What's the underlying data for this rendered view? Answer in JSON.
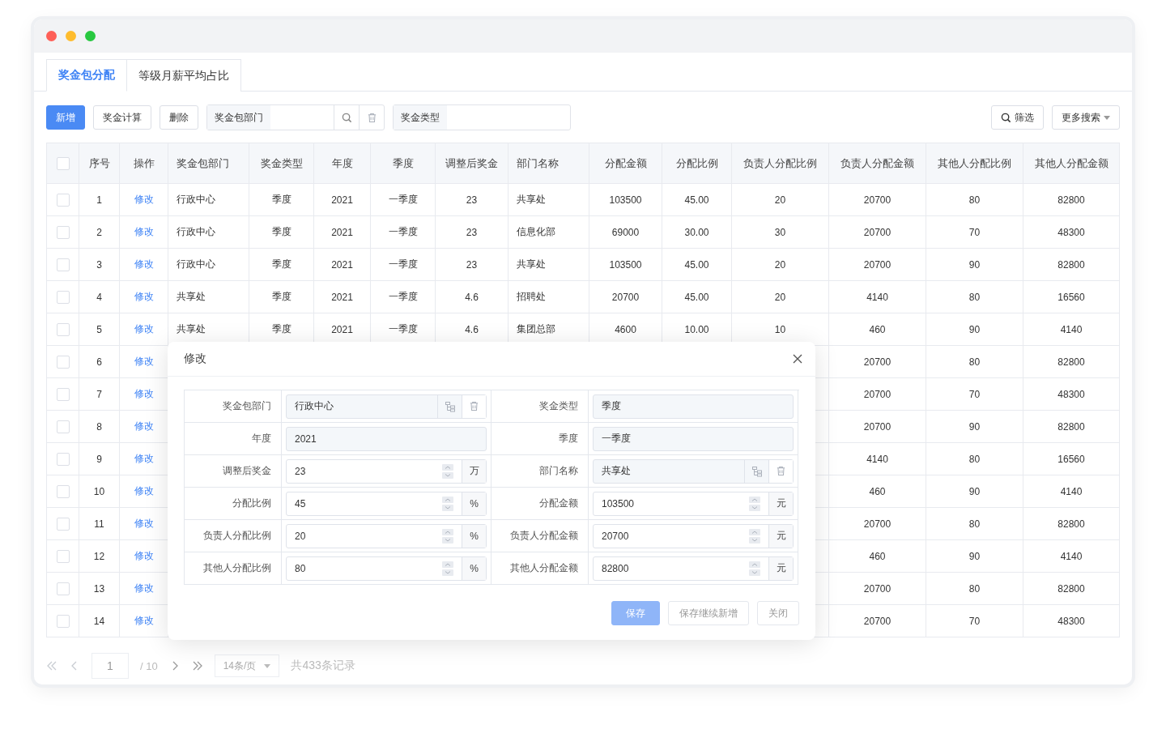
{
  "tabs": [
    {
      "label": "奖金包分配",
      "selected": true
    },
    {
      "label": "等级月薪平均占比",
      "selected": false
    }
  ],
  "toolbar": {
    "buttons": [
      {
        "label": "新增",
        "kind": "primary"
      },
      {
        "label": "奖金计算",
        "kind": "default"
      },
      {
        "label": "删除",
        "kind": "default"
      }
    ],
    "filters": [
      {
        "label": "奖金包部门",
        "kind": "search"
      },
      {
        "label": "奖金类型",
        "kind": "plain"
      }
    ],
    "right_buttons": [
      {
        "label": "筛选",
        "kind": "search"
      },
      {
        "label": "更多搜索",
        "kind": "dropdown"
      }
    ]
  },
  "table": {
    "select_all": {
      "checked": false
    },
    "columns": [
      "序号",
      "操作",
      "奖金包部门",
      "奖金类型",
      "年度",
      "季度",
      "调整后奖金",
      "部门名称",
      "分配金额",
      "分配比例",
      "负责人分配比例",
      "负责人分配金额",
      "其他人分配比例",
      "其他人分配金额"
    ],
    "rows": [
      {
        "checked": false,
        "cells": [
          "1",
          "修改",
          "行政中心",
          "季度",
          "2021",
          "一季度",
          "23",
          "共享处",
          "103500",
          "45.00",
          "20",
          "20700",
          "80",
          "82800"
        ]
      },
      {
        "checked": false,
        "cells": [
          "2",
          "修改",
          "行政中心",
          "季度",
          "2021",
          "一季度",
          "23",
          "信息化部",
          "69000",
          "30.00",
          "30",
          "20700",
          "70",
          "48300"
        ]
      },
      {
        "checked": false,
        "cells": [
          "3",
          "修改",
          "行政中心",
          "季度",
          "2021",
          "一季度",
          "23",
          "共享处",
          "103500",
          "45.00",
          "20",
          "20700",
          "90",
          "82800"
        ]
      },
      {
        "checked": false,
        "cells": [
          "4",
          "修改",
          "共享处",
          "季度",
          "2021",
          "一季度",
          "4.6",
          "招聘处",
          "20700",
          "45.00",
          "20",
          "4140",
          "80",
          "16560"
        ]
      },
      {
        "checked": false,
        "cells": [
          "5",
          "修改",
          "共享处",
          "季度",
          "2021",
          "一季度",
          "4.6",
          "集团总部",
          "4600",
          "10.00",
          "10",
          "460",
          "90",
          "4140"
        ]
      },
      {
        "checked": false,
        "cells": [
          "6",
          "修改",
          null,
          null,
          null,
          null,
          null,
          null,
          null,
          null,
          null,
          "20700",
          "80",
          "82800"
        ]
      },
      {
        "checked": false,
        "cells": [
          "7",
          "修改",
          null,
          null,
          null,
          null,
          null,
          null,
          null,
          null,
          null,
          "20700",
          "70",
          "48300"
        ]
      },
      {
        "checked": false,
        "cells": [
          "8",
          "修改",
          null,
          null,
          null,
          null,
          null,
          null,
          null,
          null,
          null,
          "20700",
          "90",
          "82800"
        ]
      },
      {
        "checked": false,
        "cells": [
          "9",
          "修改",
          null,
          null,
          null,
          null,
          null,
          null,
          null,
          null,
          null,
          "4140",
          "80",
          "16560"
        ]
      },
      {
        "checked": false,
        "cells": [
          "10",
          "修改",
          null,
          null,
          null,
          null,
          null,
          null,
          null,
          null,
          null,
          "460",
          "90",
          "4140"
        ]
      },
      {
        "checked": false,
        "cells": [
          "11",
          "修改",
          null,
          null,
          null,
          null,
          null,
          null,
          null,
          null,
          null,
          "20700",
          "80",
          "82800"
        ]
      },
      {
        "checked": false,
        "cells": [
          "12",
          "修改",
          null,
          null,
          null,
          null,
          null,
          null,
          null,
          null,
          null,
          "460",
          "90",
          "4140"
        ]
      },
      {
        "checked": false,
        "cells": [
          "13",
          "修改",
          null,
          null,
          null,
          null,
          null,
          null,
          null,
          null,
          null,
          "20700",
          "80",
          "82800"
        ]
      },
      {
        "checked": false,
        "cells": [
          "14",
          "修改",
          null,
          null,
          null,
          null,
          null,
          null,
          null,
          null,
          null,
          "20700",
          "70",
          "48300"
        ]
      }
    ]
  },
  "pagination": {
    "page": "1",
    "total_pages": "/ 10",
    "page_size": "14条/页",
    "summary": "共433条记录"
  },
  "dialog": {
    "title": "修改",
    "fields": [
      {
        "label": "奖金包部门",
        "value": "行政中心",
        "kind": "select"
      },
      {
        "label": "奖金类型",
        "value": "季度",
        "kind": "text"
      },
      {
        "label": "年度",
        "value": "2021",
        "kind": "text"
      },
      {
        "label": "季度",
        "value": "一季度",
        "kind": "text"
      },
      {
        "label": "调整后奖金",
        "value": "23",
        "kind": "number",
        "unit": "万"
      },
      {
        "label": "部门名称",
        "value": "共享处",
        "kind": "select"
      },
      {
        "label": "分配比例",
        "value": "45",
        "kind": "number",
        "unit": "%"
      },
      {
        "label": "分配金额",
        "value": "103500",
        "kind": "number",
        "unit": "元"
      },
      {
        "label": "负责人分配比例",
        "value": "20",
        "kind": "number",
        "unit": "%"
      },
      {
        "label": "负责人分配金额",
        "value": "20700",
        "kind": "number",
        "unit": "元"
      },
      {
        "label": "其他人分配比例",
        "value": "80",
        "kind": "number",
        "unit": "%"
      },
      {
        "label": "其他人分配金额",
        "value": "82800",
        "kind": "number",
        "unit": "元"
      }
    ],
    "buttons": [
      {
        "label": "保存",
        "kind": "primary",
        "disabled": true
      },
      {
        "label": "保存继续新增",
        "kind": "default"
      },
      {
        "label": "关闭",
        "kind": "default"
      }
    ]
  }
}
